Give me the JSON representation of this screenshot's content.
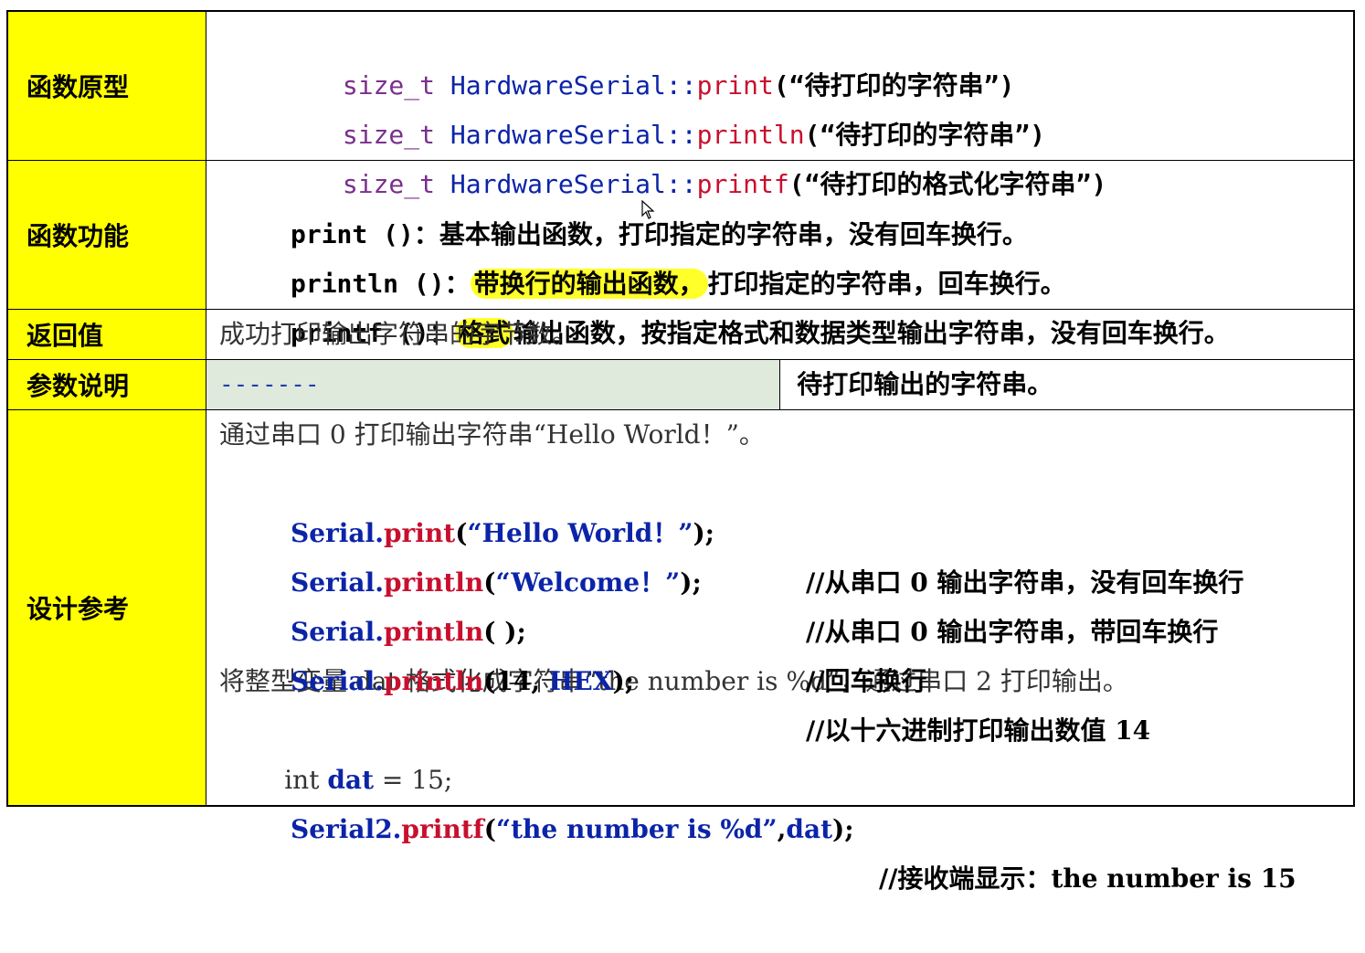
{
  "rows": {
    "prototype": {
      "label": "函数原型",
      "lines": [
        {
          "prefix": "size_t ",
          "cls": "HardwareSerial::",
          "fn": "print",
          "arg": "(“待打印的字符串”)"
        },
        {
          "prefix": "size_t ",
          "cls": "HardwareSerial::",
          "fn": "println",
          "arg": "(“待打印的字符串”)"
        },
        {
          "prefix": "size_t ",
          "cls": "HardwareSerial::",
          "fn": "printf",
          "arg": "(“待打印的格式化字符串”)"
        }
      ]
    },
    "function": {
      "label": "函数功能",
      "l1": {
        "code": "print ()",
        "text": "：基本输出函数，打印指定的字符串，没有回车换行。"
      },
      "l2": {
        "code": "println ()",
        "sep": "：",
        "hl": "带换行的输出函数，",
        "text": "打印指定的字符串，回车换行。"
      },
      "l3": {
        "code": "printf ()",
        "sep": "：",
        "hl": "格式",
        "text": "输出函数，按指定格式和数据类型输出字符串，没有回车换行。"
      }
    },
    "return": {
      "label": "返回值",
      "text": "成功打印输出字符串的字节数。"
    },
    "params": {
      "label": "参数说明",
      "name": "-------",
      "desc": "待打印输出的字符串。"
    },
    "design": {
      "label": "设计参考",
      "desc1": "通过串口 0 打印输出字符串“Hello World！”。",
      "code1": {
        "obj": "Serial.",
        "fn": "print",
        "open": "(",
        "str": "“Hello World！”",
        "close": ");",
        "comment": "//从串口 0 输出字符串，没有回车换行"
      },
      "code2": {
        "obj": "Serial.",
        "fn": "println",
        "open": "(",
        "str": "“Welcome！”",
        "close": ");",
        "comment": "//从串口 0 输出字符串，带回车换行"
      },
      "code3": {
        "obj": "Serial.",
        "fn": "println",
        "open": "( );",
        "comment": "//回车换行"
      },
      "code4": {
        "obj": "Serial.",
        "fn": "println",
        "open": "(14, ",
        "hex": "HEX",
        "close": ");",
        "comment": "//以十六进制打印输出数值 14"
      },
      "desc2": "将整型变量 dat 格式化成字符串“the number is %d”，通过串口 2 打印输出。",
      "code5": {
        "kw": "int ",
        "var": "dat",
        "rest": " = 15;"
      },
      "code6": {
        "obj": "Serial2.",
        "fn": "printf",
        "open": "(",
        "str": "“the number is %d”",
        "mid": ",",
        "var": "dat",
        "close": ");",
        "comment": "//接收端显示：the number is 15"
      }
    }
  },
  "colors": {
    "label_bg": "#ffff00",
    "highlight": "#ffff2a",
    "param_cell": "#dfe9dc"
  }
}
